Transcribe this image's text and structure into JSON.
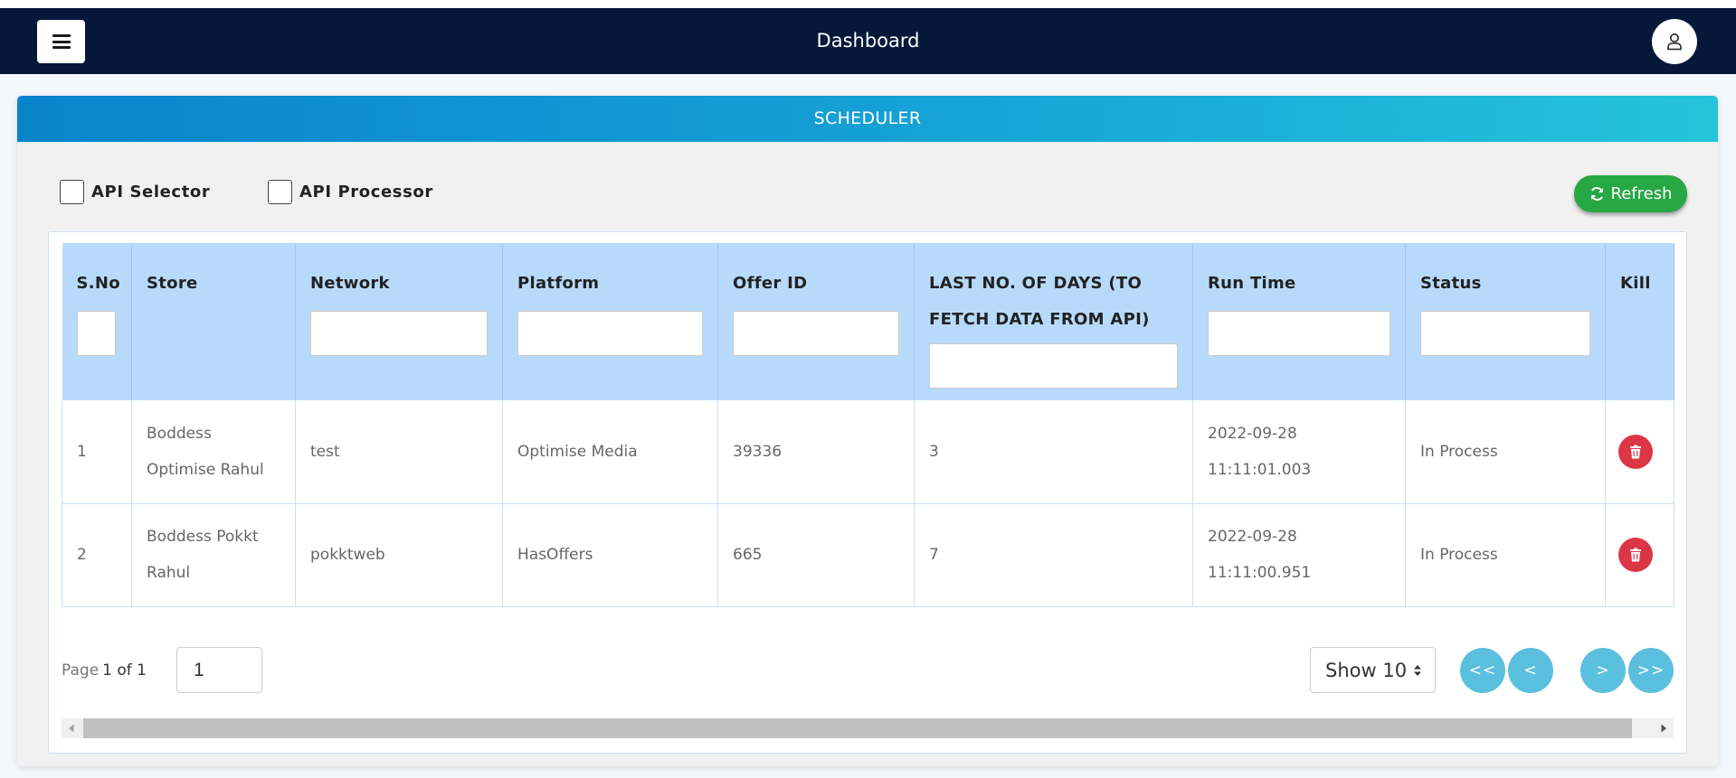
{
  "navbar": {
    "title": "Dashboard",
    "menu_icon": "hamburger-icon",
    "user_icon": "user-icon",
    "bg_color": "#061839"
  },
  "card": {
    "title": "SCHEDULER"
  },
  "filters": {
    "api_selector": "API Selector",
    "api_processor": "API Processor"
  },
  "refresh": {
    "label": "Refresh",
    "icon": "refresh-icon",
    "color": "#28a745"
  },
  "table": {
    "columns": [
      {
        "label": "S.No"
      },
      {
        "label": "Store"
      },
      {
        "label": "Network"
      },
      {
        "label": "Platform"
      },
      {
        "label": "Offer ID"
      },
      {
        "label": "LAST NO. OF DAYS (TO FETCH DATA FROM API)"
      },
      {
        "label": "Run Time"
      },
      {
        "label": "Status"
      },
      {
        "label": "Kill"
      }
    ],
    "rows": [
      {
        "sno": "1",
        "store": "Boddess Optimise Rahul",
        "network": "test",
        "platform": "Optimise Media",
        "offer_id": "39336",
        "days": "3",
        "run_time": "2022-09-28 11:11:01.003",
        "status": "In Process"
      },
      {
        "sno": "2",
        "store": "Boddess Pokkt Rahul",
        "network": "pokktweb",
        "platform": "HasOffers",
        "offer_id": "665",
        "days": "7",
        "run_time": "2022-09-28 11:11:00.951",
        "status": "In Process"
      }
    ],
    "header_color": "#b8dafa",
    "kill_color": "#dc3545"
  },
  "pagination": {
    "page_word": "Page",
    "current": "1 of 1",
    "page_input_value": "1",
    "show_label": "Show 10",
    "first": "<<",
    "prev": "<",
    "next": ">",
    "last": ">>",
    "button_color": "#5bc0de"
  }
}
